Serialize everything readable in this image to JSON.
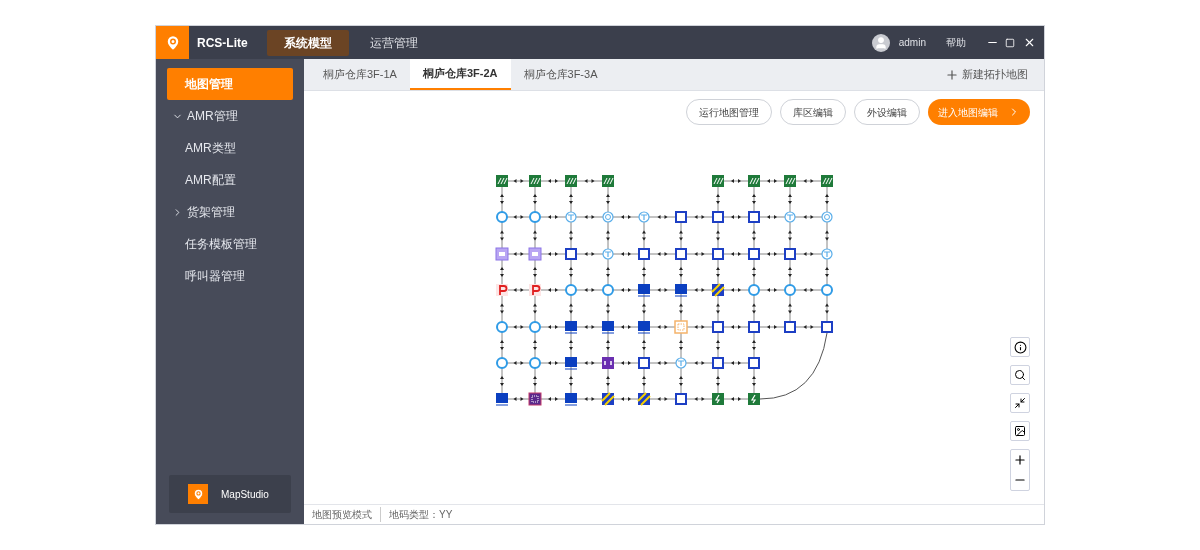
{
  "app": {
    "title": "RCS-Lite"
  },
  "top_menu": [
    {
      "label": "系统模型",
      "selected": true
    },
    {
      "label": "运营管理",
      "selected": false
    }
  ],
  "user": {
    "name": "admin"
  },
  "help": "帮助",
  "sidebar": {
    "items": [
      {
        "label": "地图管理",
        "selected": true
      },
      {
        "label": "AMR管理",
        "selected": false,
        "expanded": true,
        "children": [
          {
            "label": "AMR类型",
            "selected": false
          },
          {
            "label": "AMR配置",
            "selected": false
          }
        ]
      },
      {
        "label": "货架管理",
        "selected": false,
        "expanded": false
      },
      {
        "label": "任务模板管理",
        "selected": false
      },
      {
        "label": "呼叫器管理",
        "selected": false
      }
    ],
    "footer": "MapStudio"
  },
  "tabs": [
    {
      "label": "桐庐仓库3F-1A",
      "selected": false
    },
    {
      "label": "桐庐仓库3F-2A",
      "selected": true
    },
    {
      "label": "桐庐仓库3F-3A",
      "selected": false
    }
  ],
  "new_map": "新建拓扑地图",
  "toolbar": [
    {
      "label": "运行地图管理",
      "kind": "outline"
    },
    {
      "label": "库区编辑",
      "kind": "outline"
    },
    {
      "label": "外设编辑",
      "kind": "outline"
    },
    {
      "label": "进入地图编辑",
      "kind": "primary"
    }
  ],
  "map": {
    "rows": [
      {
        "nodes": [
          {
            "kind": "dock"
          },
          {
            "kind": "dock"
          },
          {
            "kind": "dock"
          },
          {
            "kind": "dock"
          },
          {
            "kind": "gap"
          },
          {
            "kind": "gap"
          },
          {
            "kind": "dock"
          },
          {
            "kind": "dock"
          },
          {
            "kind": "dock"
          },
          {
            "kind": "dock"
          }
        ]
      },
      {
        "nodes": [
          {
            "kind": "circle"
          },
          {
            "kind": "circle"
          },
          {
            "kind": "tee"
          },
          {
            "kind": "cycle"
          },
          {
            "kind": "tee"
          },
          {
            "kind": "square"
          },
          {
            "kind": "square"
          },
          {
            "kind": "square"
          },
          {
            "kind": "tee"
          },
          {
            "kind": "cycle"
          }
        ]
      },
      {
        "nodes": [
          {
            "kind": "screen"
          },
          {
            "kind": "screen"
          },
          {
            "kind": "square"
          },
          {
            "kind": "tee"
          },
          {
            "kind": "square"
          },
          {
            "kind": "square"
          },
          {
            "kind": "square"
          },
          {
            "kind": "square"
          },
          {
            "kind": "square"
          },
          {
            "kind": "tee"
          }
        ]
      },
      {
        "nodes": [
          {
            "kind": "park"
          },
          {
            "kind": "park"
          },
          {
            "kind": "circle"
          },
          {
            "kind": "circle"
          },
          {
            "kind": "solid"
          },
          {
            "kind": "solid"
          },
          {
            "kind": "stripe"
          },
          {
            "kind": "circle"
          },
          {
            "kind": "circle"
          },
          {
            "kind": "circle"
          }
        ]
      },
      {
        "nodes": [
          {
            "kind": "circle"
          },
          {
            "kind": "circle"
          },
          {
            "kind": "solid"
          },
          {
            "kind": "solid"
          },
          {
            "kind": "solid"
          },
          {
            "kind": "pending"
          },
          {
            "kind": "square"
          },
          {
            "kind": "square"
          },
          {
            "kind": "square"
          },
          {
            "kind": "square"
          }
        ]
      },
      {
        "nodes": [
          {
            "kind": "circle"
          },
          {
            "kind": "circle"
          },
          {
            "kind": "solid"
          },
          {
            "kind": "lift"
          },
          {
            "kind": "square"
          },
          {
            "kind": "tee"
          },
          {
            "kind": "square"
          },
          {
            "kind": "square"
          },
          {
            "kind": "gap"
          },
          {
            "kind": "gap"
          }
        ]
      },
      {
        "nodes": [
          {
            "kind": "solid"
          },
          {
            "kind": "grid"
          },
          {
            "kind": "solid"
          },
          {
            "kind": "stripe"
          },
          {
            "kind": "stripe"
          },
          {
            "kind": "square"
          },
          {
            "kind": "charge"
          },
          {
            "kind": "charge"
          },
          {
            "kind": "gap"
          },
          {
            "kind": "gap"
          }
        ]
      }
    ]
  },
  "status_bar": [
    "地图预览模式",
    "地码类型：YY"
  ]
}
